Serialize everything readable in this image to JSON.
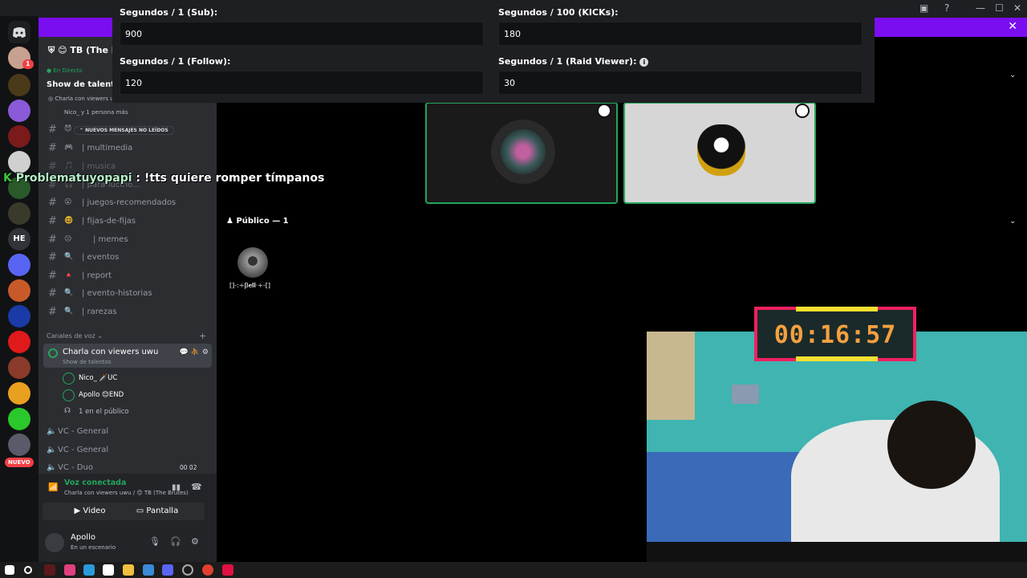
{
  "window": {
    "minimize": "—",
    "maximize": "☐",
    "close": "✕"
  },
  "banner": {
    "close": "✕"
  },
  "rail": {
    "text_server": "HE",
    "new_badge": "NUEVO",
    "badge_count": "1"
  },
  "sidebar": {
    "server_name": "TB (The B",
    "live_label": "En Directo",
    "event_title": "Show de talentos",
    "event_channel": "Charla con viewers uwu",
    "event_people": "Nico_ y 1 persona más",
    "unread_pill": "NUEVOS MENSAJES NO LEÍDOS",
    "text_channels": [
      {
        "emoji": "🎮",
        "name": "| multimedia"
      },
      {
        "emoji": "🎵",
        "name": "| musica"
      },
      {
        "emoji": "🎧",
        "name": "| para-lucirlo..."
      },
      {
        "emoji": "😮",
        "name": "| juegos-recomendados"
      },
      {
        "emoji": "🤓",
        "name": "| fijas-de-fijas"
      },
      {
        "emoji": "😕",
        "name": "| memes"
      },
      {
        "emoji": "🔍",
        "name": "| eventos"
      },
      {
        "emoji": "🔺",
        "name": "| report"
      },
      {
        "emoji": "🔍",
        "name": "| evento-historias"
      },
      {
        "emoji": "🔍",
        "name": "| rarezas"
      }
    ],
    "voice_category": "Canales de voz",
    "active_voice": {
      "name": "Charla con viewers uwu",
      "sub": "Show de talentos",
      "members": [
        {
          "name": "Nico_ 🗡️UC"
        },
        {
          "name": "Apollo 😊END"
        }
      ],
      "audience": "1 en el público"
    },
    "voice_channels": [
      "VC - General",
      "VC - General",
      "VC - Duo"
    ],
    "duo_count": "00 02"
  },
  "voice_panel": {
    "status": "Voz conectada",
    "where": "Charla con viewers uwu / 😊 TB (The Brutes)",
    "video_label": "Video",
    "screen_label": "Pantalla"
  },
  "user": {
    "name": "Apollo",
    "status": "En un escenario"
  },
  "settings": {
    "sub_label": "Segundos / 1 (Sub):",
    "sub_value": "900",
    "kicks_label": "Segundos / 100 (KICKs):",
    "kicks_value": "180",
    "follow_label": "Segundos / 1 (Follow):",
    "follow_value": "120",
    "raid_label": "Segundos / 1 (Raid Viewer):",
    "raid_value": "30"
  },
  "stage": {
    "public_label": "Público — 1",
    "public_member": "[]-:÷Ꞵ𝐞𝐥𝐥·÷-[]"
  },
  "chat": {
    "user": "Problematuyopapi",
    "message": " : !tts quiere romper tímpanos"
  },
  "timer": {
    "value": "00:16:57"
  },
  "colors": {
    "accent_purple": "#7a0ef0",
    "voice_green": "#23a55a",
    "timer_border": "#f02060",
    "timer_text": "#f4a040"
  }
}
